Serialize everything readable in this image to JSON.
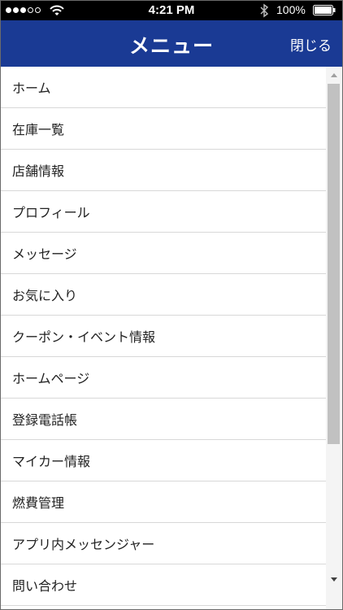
{
  "status_bar": {
    "time": "4:21 PM",
    "battery_percent": "100%",
    "signal_bars": 3,
    "signal_total": 5
  },
  "header": {
    "title": "メニュー",
    "close_label": "閉じる"
  },
  "menu": {
    "items": [
      {
        "label": "ホーム"
      },
      {
        "label": "在庫一覧"
      },
      {
        "label": "店舗情報"
      },
      {
        "label": "プロフィール"
      },
      {
        "label": "メッセージ"
      },
      {
        "label": "お気に入り"
      },
      {
        "label": "クーポン・イベント情報"
      },
      {
        "label": "ホームページ"
      },
      {
        "label": "登録電話帳"
      },
      {
        "label": "マイカー情報"
      },
      {
        "label": "燃費管理"
      },
      {
        "label": "アプリ内メッセンジャー"
      },
      {
        "label": "問い合わせ"
      }
    ]
  },
  "colors": {
    "header_bg": "#1a3a94",
    "status_bar_bg": "#000000"
  },
  "icons": {
    "signal": "signal-dots-icon",
    "wifi": "wifi-icon",
    "bluetooth": "bluetooth-icon",
    "battery": "battery-icon"
  }
}
